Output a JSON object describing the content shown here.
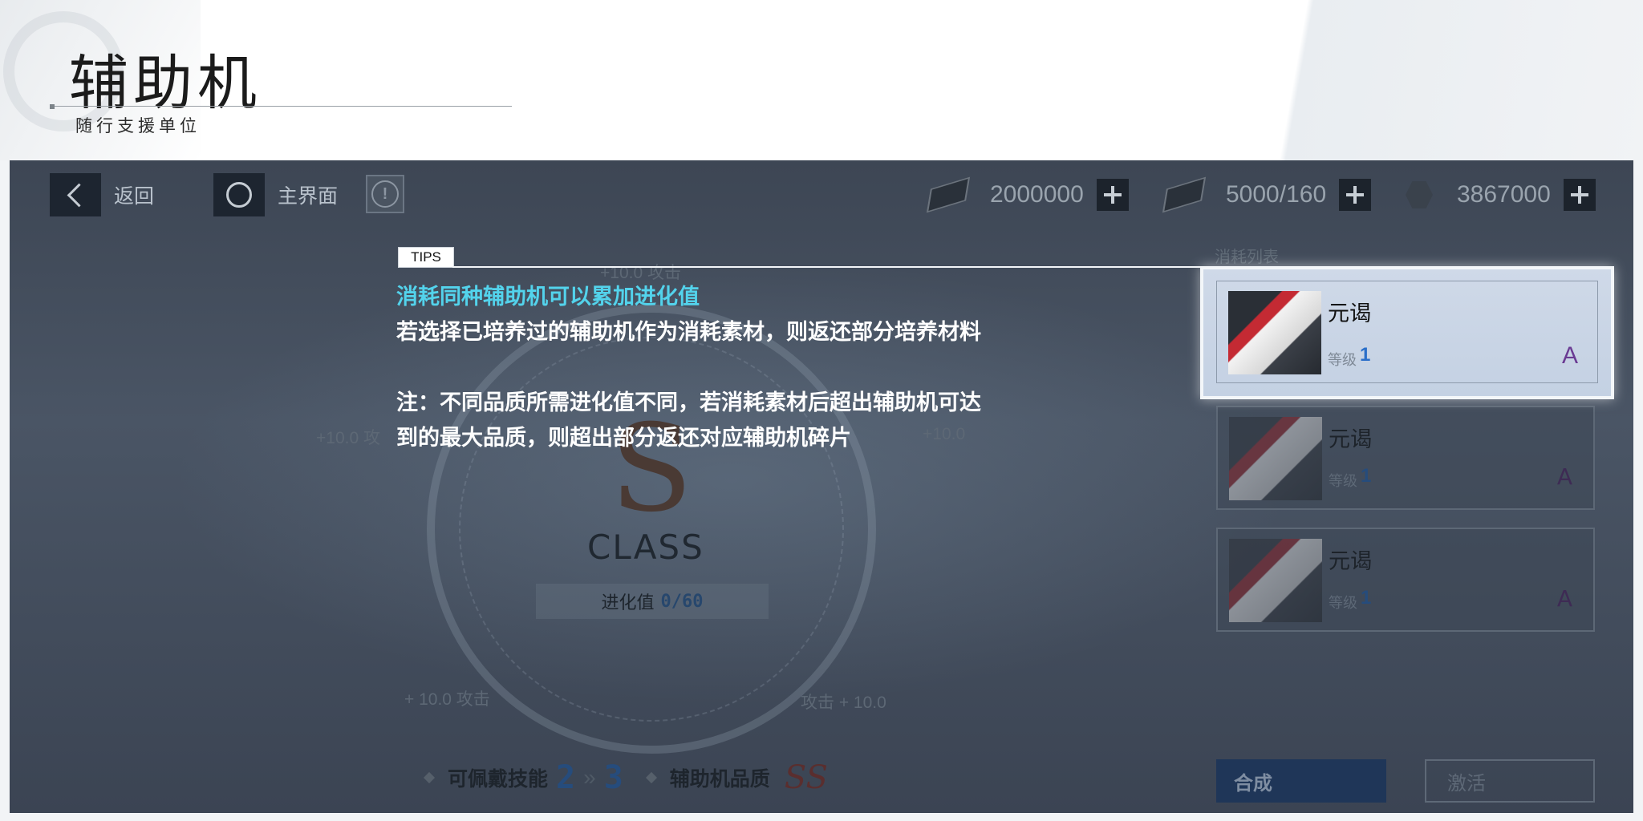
{
  "header": {
    "title": "辅助机",
    "subtitle": "随行支援单位"
  },
  "topbar": {
    "back_label": "返回",
    "home_label": "主界面",
    "resources": [
      {
        "icon": "chip-icon",
        "value": "2000000"
      },
      {
        "icon": "card-icon",
        "value": "5000/160"
      },
      {
        "icon": "hexagon-icon",
        "value": "3867000"
      }
    ]
  },
  "center": {
    "class_letter": "S",
    "class_word": "CLASS",
    "evolution_label": "进化值",
    "evolution_value": "0/60",
    "bonuses": {
      "top": "+10.0 攻击",
      "left": "+10.0 攻",
      "right": "+10.0",
      "bottom_left": "+ 10.0 攻击",
      "bottom_right": "攻击 + 10.0"
    }
  },
  "bottom": {
    "skills_label": "可佩戴技能",
    "skills_from": "2",
    "skills_sep": "»",
    "skills_to": "3",
    "quality_label": "辅助机品质",
    "quality_value": "SS",
    "synth_button": "合成",
    "activate_button": "激活"
  },
  "consume_list": {
    "title": "消耗列表",
    "items": [
      {
        "name": "元谒",
        "level_label": "等级",
        "level": "1",
        "grade": "A"
      },
      {
        "name": "元谒",
        "level_label": "等级",
        "level": "1",
        "grade": "A"
      },
      {
        "name": "元谒",
        "level_label": "等级",
        "level": "1",
        "grade": "A"
      }
    ]
  },
  "tips": {
    "badge": "TIPS",
    "headline": "消耗同种辅助机可以累加进化值",
    "line1": "若选择已培养过的辅助机作为消耗素材，则返还部分培养材料",
    "note_line1": "注：不同品质所需进化值不同，若消耗素材后超出辅助机可达",
    "note_line2": "到的最大品质，则超出部分返还对应辅助机碎片"
  },
  "colors": {
    "tips_headline": "#53d3ec",
    "level_number": "#2a6fc9",
    "grade_A": "#6a3b93"
  }
}
